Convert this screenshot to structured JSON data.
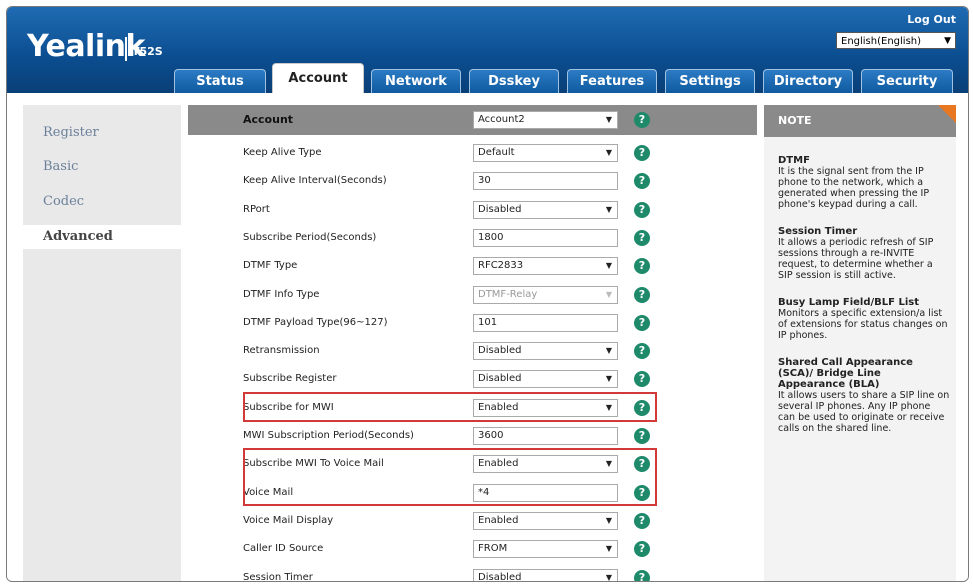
{
  "header": {
    "logo": "Yealink",
    "model": "T52S",
    "logout": "Log Out",
    "language": "English(English)"
  },
  "tabs": [
    "Status",
    "Account",
    "Network",
    "Dsskey",
    "Features",
    "Settings",
    "Directory",
    "Security"
  ],
  "active_tab": "Account",
  "sidebar": {
    "items": [
      {
        "label": "Register"
      },
      {
        "label": "Basic"
      },
      {
        "label": "Codec"
      },
      {
        "label": "Advanced"
      }
    ],
    "active": "Advanced"
  },
  "form": {
    "header": {
      "label": "Account",
      "value": "Account2",
      "type": "select"
    },
    "rows": [
      {
        "label": "Keep Alive Type",
        "value": "Default",
        "type": "select"
      },
      {
        "label": "Keep Alive Interval(Seconds)",
        "value": "30",
        "type": "input"
      },
      {
        "label": "RPort",
        "value": "Disabled",
        "type": "select"
      },
      {
        "label": "Subscribe Period(Seconds)",
        "value": "1800",
        "type": "input"
      },
      {
        "label": "DTMF Type",
        "value": "RFC2833",
        "type": "select"
      },
      {
        "label": "DTMF Info Type",
        "value": "DTMF-Relay",
        "type": "select-disabled"
      },
      {
        "label": "DTMF Payload Type(96~127)",
        "value": "101",
        "type": "input"
      },
      {
        "label": "Retransmission",
        "value": "Disabled",
        "type": "select"
      },
      {
        "label": "Subscribe Register",
        "value": "Disabled",
        "type": "select"
      },
      {
        "label": "Subscribe for MWI",
        "value": "Enabled",
        "type": "select"
      },
      {
        "label": "MWI Subscription Period(Seconds)",
        "value": "3600",
        "type": "input"
      },
      {
        "label": "Subscribe MWI To Voice Mail",
        "value": "Enabled",
        "type": "select"
      },
      {
        "label": "Voice Mail",
        "value": "*4",
        "type": "input"
      },
      {
        "label": "Voice Mail Display",
        "value": "Enabled",
        "type": "select"
      },
      {
        "label": "Caller ID Source",
        "value": "FROM",
        "type": "select"
      },
      {
        "label": "Session Timer",
        "value": "Disabled",
        "type": "select"
      }
    ],
    "help_glyph": "?"
  },
  "note": {
    "title": "NOTE",
    "sections": [
      {
        "heading": "DTMF",
        "text": "It is the signal sent from the IP phone to the network, which a generated when pressing the IP phone's keypad during a call."
      },
      {
        "heading": "Session Timer",
        "text": "It allows a periodic refresh of SIP sessions through a re-INVITE request, to determine whether a SIP session is still active."
      },
      {
        "heading": "Busy Lamp Field/BLF List",
        "text": "Monitors a specific extension/a list of extensions for status changes on IP phones."
      },
      {
        "heading": "Shared Call Appearance (SCA)/ Bridge Line Appearance (BLA)",
        "text": "It allows users to share a SIP line on several IP phones. Any IP phone can be used to originate or receive calls on the shared line."
      }
    ]
  },
  "colors": {
    "header_blue": "#0b4d8f",
    "highlight_red": "#d23a3a",
    "help_green": "#1e8a6a",
    "note_accent": "#e87722"
  }
}
